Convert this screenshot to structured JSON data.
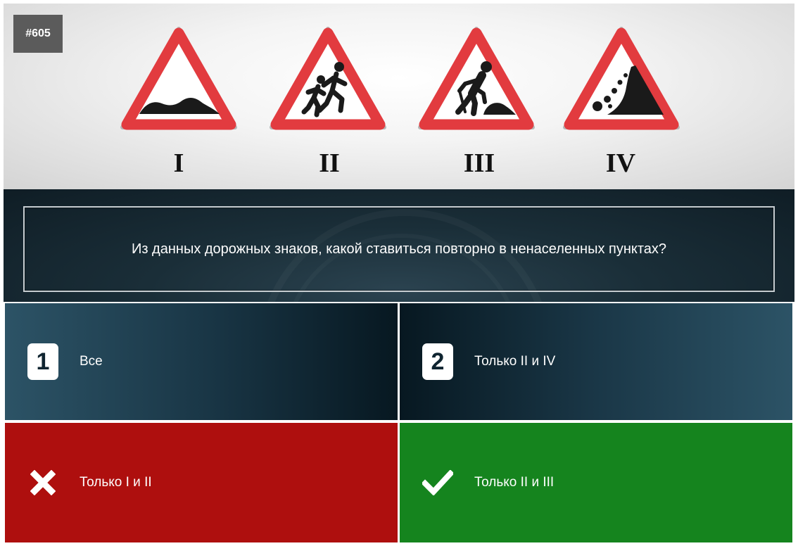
{
  "question": {
    "id_badge": "#605",
    "text": "Из данных дорожных знаков, какой ставиться повторно в ненаселенных пунктах?"
  },
  "signs": [
    {
      "numeral": "I",
      "icon": "uneven-road-icon"
    },
    {
      "numeral": "II",
      "icon": "children-icon"
    },
    {
      "numeral": "III",
      "icon": "road-works-icon"
    },
    {
      "numeral": "IV",
      "icon": "falling-rocks-icon"
    }
  ],
  "answers": [
    {
      "number": "1",
      "label": "Все",
      "state": "neutral"
    },
    {
      "number": "2",
      "label": "Только II и IV",
      "state": "neutral"
    },
    {
      "label": "Только I и II",
      "state": "wrong",
      "icon": "cross-icon"
    },
    {
      "label": "Только II и III",
      "state": "correct",
      "icon": "checkmark-icon"
    }
  ],
  "colors": {
    "sign_border": "#e23b3f",
    "wrong": "#ae0f0e",
    "correct": "#15841e",
    "panel": "#1a2e38"
  }
}
